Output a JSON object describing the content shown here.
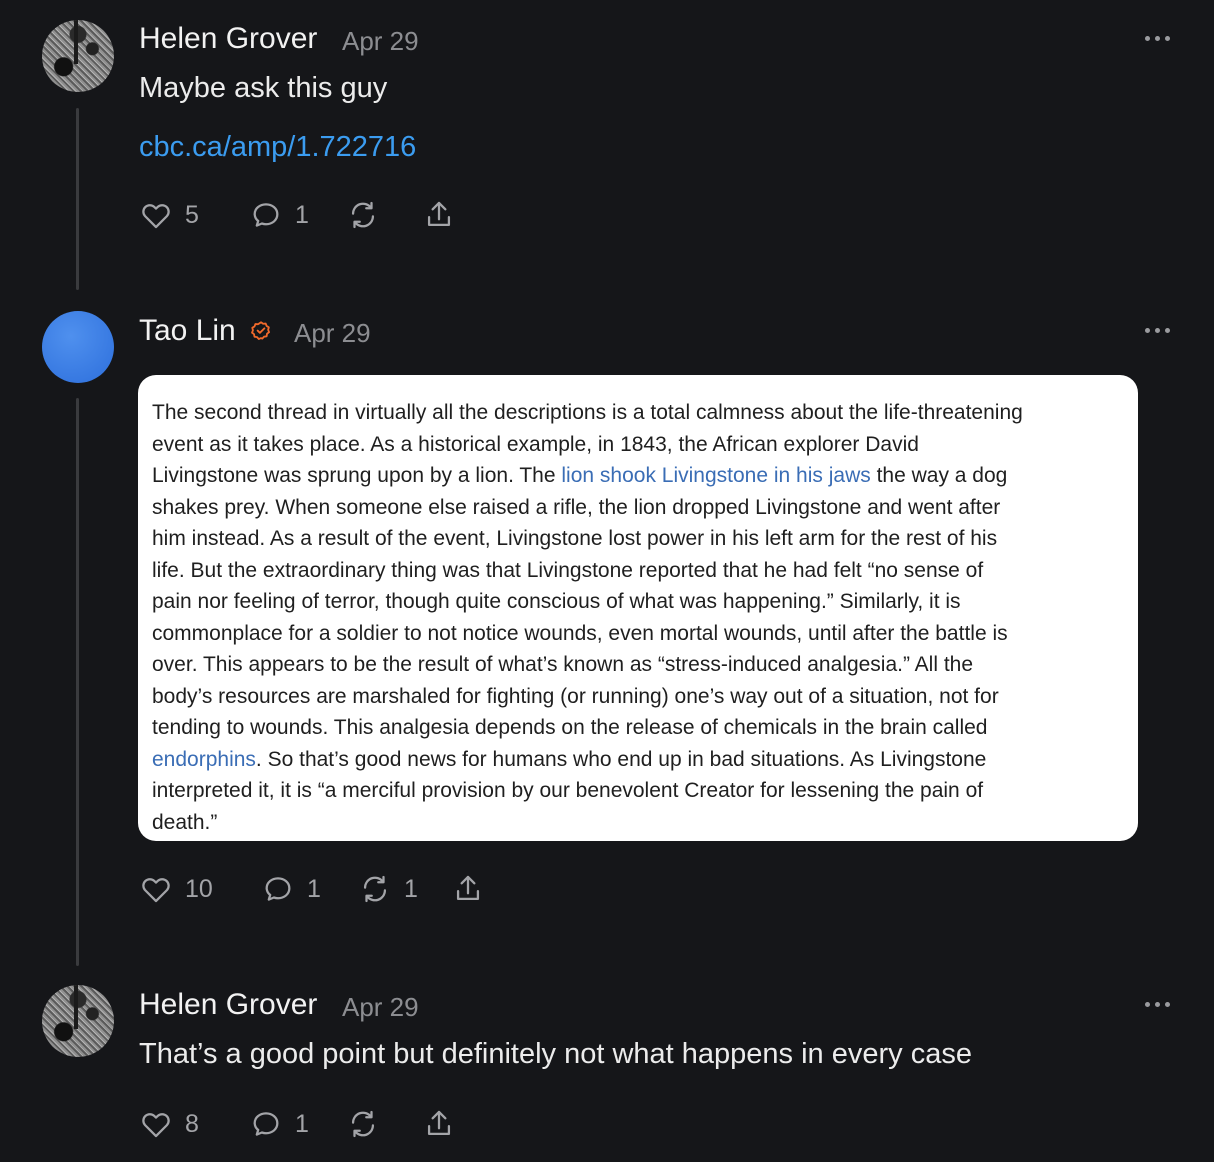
{
  "posts": [
    {
      "author": "Helen Grover",
      "date": "Apr 29",
      "text": "Maybe ask this guy",
      "link": "cbc.ca/amp/1.722716",
      "likes": "5",
      "comments": "1",
      "restacks": ""
    },
    {
      "author": "Tao Lin",
      "date": "Apr 29",
      "verified": true,
      "quote": {
        "lines": [
          [
            "The second thread in virtually all the descriptions is a total calmness about the life-threatening"
          ],
          [
            "event as it takes place. As a historical example, in 1843, the African explorer David"
          ],
          [
            "Livingstone was sprung upon by a lion. The ",
            {
              "link": "lion shook Livingstone in his jaws"
            },
            " the way a dog"
          ],
          [
            "shakes prey. When someone else raised a rifle, the lion dropped Livingstone and went after"
          ],
          [
            "him instead. As a result of the event, Livingstone lost power in his left arm for the rest of his"
          ],
          [
            "life. But the extraordinary thing was that Livingstone reported that he had felt “no sense of"
          ],
          [
            "pain nor feeling of terror, though quite conscious of what was happening.” Similarly, it is"
          ],
          [
            "commonplace for a soldier to not notice wounds, even mortal wounds, until after the battle is"
          ],
          [
            "over. This appears to be the result of what’s known as “stress-induced analgesia.” All the"
          ],
          [
            "body’s resources are marshaled for fighting (or running) one’s way out of a situation, not for"
          ],
          [
            "tending to wounds. This analgesia depends on the release of chemicals in the brain called"
          ],
          [
            {
              "link": "endorphins"
            },
            ". So that’s good news for humans who end up in bad situations. As Livingstone"
          ],
          [
            "interpreted it, it is “a merciful provision by our benevolent Creator for lessening the pain of"
          ],
          [
            "death.”"
          ]
        ]
      },
      "likes": "10",
      "comments": "1",
      "restacks": "1"
    },
    {
      "author": "Helen Grover",
      "date": "Apr 29",
      "text": "That’s a good point but definitely not what happens in every case",
      "likes": "8",
      "comments": "1",
      "restacks": ""
    }
  ],
  "icons": {
    "like": "heart-icon",
    "comment": "comment-icon",
    "restack": "restack-icon",
    "share": "share-icon",
    "more": "more-icon",
    "verified": "verified-badge-icon"
  },
  "colors": {
    "background": "#151619",
    "link": "#3b9cf0",
    "quote_link": "#3a6db5",
    "verified": "#f26a2b",
    "avatar_blue": "#3b7fe6"
  }
}
